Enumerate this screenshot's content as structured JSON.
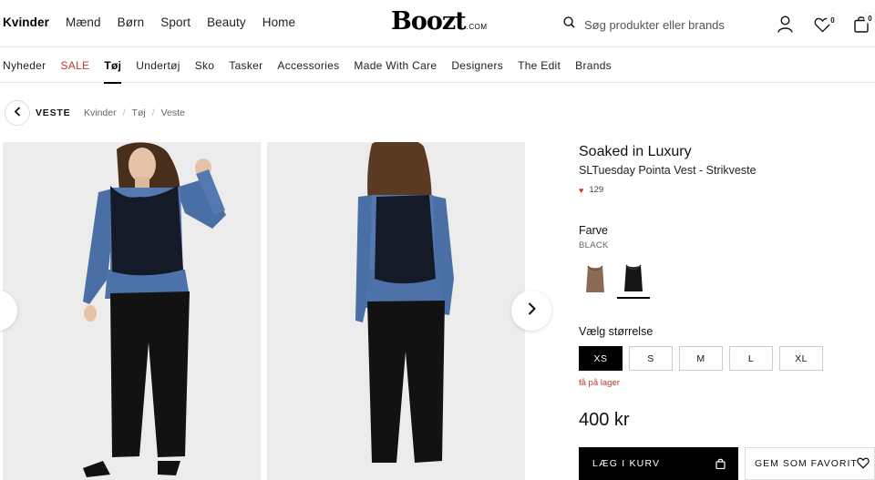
{
  "header": {
    "main_categories": [
      "Kvinder",
      "Mænd",
      "Børn",
      "Sport",
      "Beauty",
      "Home"
    ],
    "logo": "Boozt",
    "logo_suffix": ".COM",
    "search_placeholder": "Søg produkter eller brands",
    "wishlist_count": "0",
    "cart_count": "0",
    "icons": [
      "search-icon",
      "user-icon",
      "heart-icon",
      "bag-icon"
    ]
  },
  "sub_nav": {
    "items": [
      "Nyheder",
      "SALE",
      "Tøj",
      "Undertøj",
      "Sko",
      "Tasker",
      "Accessories",
      "Made With Care",
      "Designers",
      "The Edit",
      "Brands"
    ],
    "active": "Tøj",
    "sale_color": "#c0392b"
  },
  "breadcrumb": {
    "back_label": "VESTE",
    "items": [
      "Kvinder",
      "Tøj",
      "Veste"
    ]
  },
  "product": {
    "brand": "Soaked in Luxury",
    "name": "SLTuesday Pointa Vest - Strikveste",
    "likes": "129",
    "color_title": "Farve",
    "color_value": "BLACK",
    "swatches": [
      {
        "name": "brown",
        "color": "#8a6a55",
        "selected": false
      },
      {
        "name": "black",
        "color": "#151515",
        "selected": true
      }
    ],
    "size_title": "Vælg størrelse",
    "sizes": [
      "XS",
      "S",
      "M",
      "L",
      "XL"
    ],
    "selected_size": "XS",
    "stock_text": "få på lager",
    "price": "400 kr",
    "add_to_cart": "LÆG I KURV",
    "favorite": "GEM SOM FAVORIT"
  }
}
